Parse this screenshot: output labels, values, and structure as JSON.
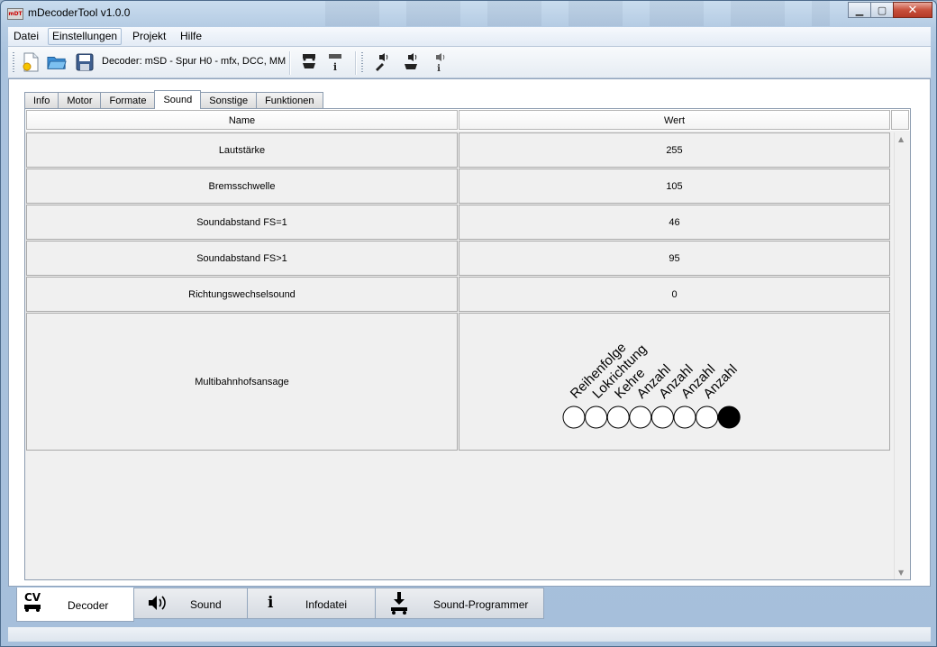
{
  "window": {
    "title": "mDecoderTool v1.0.0",
    "logo_text": "mDT"
  },
  "window_buttons": {
    "minimize": "▁",
    "maximize": "▢",
    "close": "✕"
  },
  "menu": [
    "Datei",
    "Einstellungen",
    "Projekt",
    "Hilfe"
  ],
  "toolbar": {
    "decoder_label": "Decoder: mSD - Spur H0 - mfx, DCC, MM",
    "icons": [
      "new-file-icon",
      "open-folder-icon",
      "save-disk-icon",
      "read-decoder-icon",
      "decoder-info-icon",
      "sound-edit-icon",
      "sound-read-icon",
      "sound-info-icon"
    ]
  },
  "tabs": [
    "Info",
    "Motor",
    "Formate",
    "Sound",
    "Sonstige",
    "Funktionen"
  ],
  "selected_tab": "Sound",
  "table": {
    "headers": [
      "Name",
      "Wert"
    ],
    "rows": [
      {
        "name": "Lautstärke",
        "value": "255"
      },
      {
        "name": "Bremsschwelle",
        "value": "105"
      },
      {
        "name": "Soundabstand FS=1",
        "value": "46"
      },
      {
        "name": "Soundabstand FS>1",
        "value": "95"
      },
      {
        "name": "Richtungswechselsound",
        "value": "0"
      }
    ],
    "bit_row": {
      "name": "Multibahnhofsansage",
      "bit_labels": [
        "Reihenfolge",
        "Lokrichtung",
        "Kehre",
        "Anzahl",
        "Anzahl",
        "Anzahl",
        "Anzahl"
      ],
      "bits": [
        0,
        0,
        0,
        0,
        0,
        0,
        0,
        1
      ]
    }
  },
  "bottom_tabs": [
    {
      "label": "Decoder",
      "icon": "cv-locomotive-icon",
      "icon_text": "CV",
      "selected": true
    },
    {
      "label": "Sound",
      "icon": "speaker-icon",
      "selected": false
    },
    {
      "label": "Infodatei",
      "icon": "info-icon",
      "icon_text": "i",
      "selected": false
    },
    {
      "label": "Sound-Programmer",
      "icon": "download-arrow-icon",
      "selected": false
    }
  ]
}
